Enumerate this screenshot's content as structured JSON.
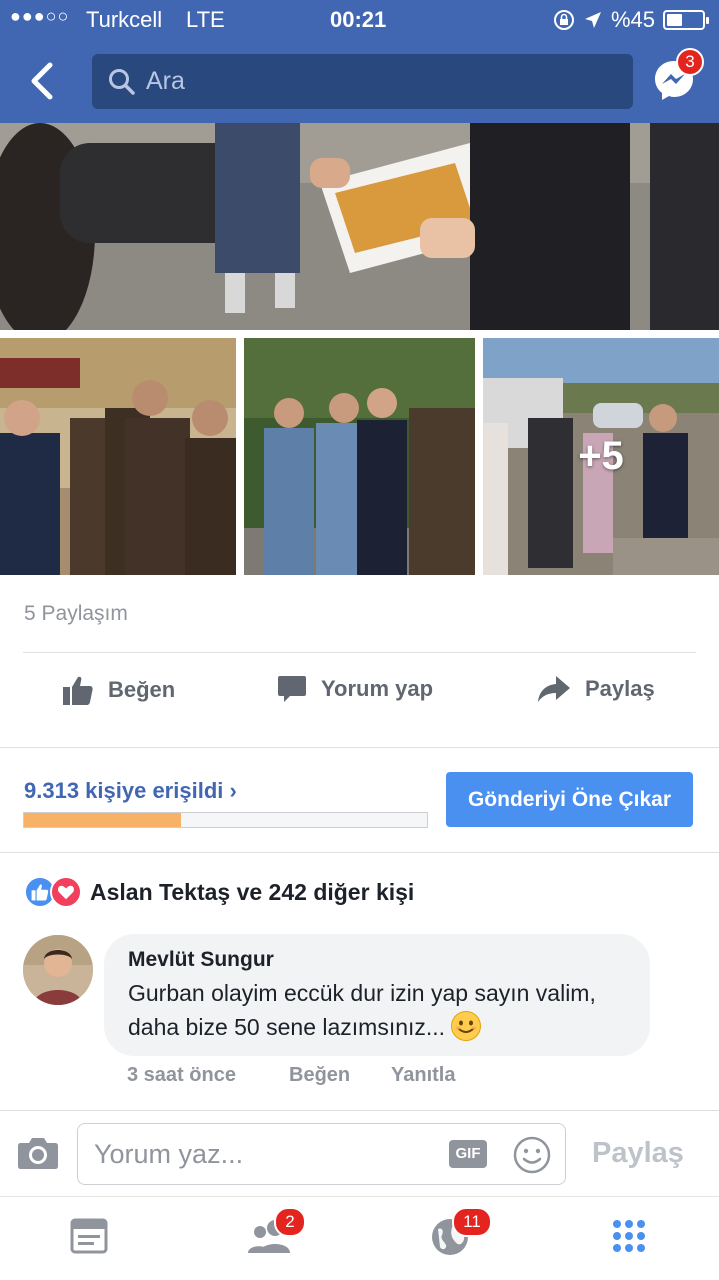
{
  "status_bar": {
    "signal": "●●●○○",
    "carrier": "Turkcell",
    "network": "LTE",
    "time": "00:21",
    "battery_text": "%45",
    "battery_level": 0.45
  },
  "nav": {
    "search_placeholder": "Ara",
    "messenger_badge": "3"
  },
  "photos": {
    "more_count": "+5"
  },
  "post": {
    "shares_text": "5 Paylaşım",
    "actions": {
      "like": "Beğen",
      "comment": "Yorum yap",
      "share": "Paylaş"
    },
    "reach_text": "9.313 kişiye erişildi",
    "reach_chevron": "›",
    "reach_progress": 0.39,
    "boost_label": "Gönderiyi Öne Çıkar",
    "reactions_text": "Aslan Tektaş ve 242 diğer kişi"
  },
  "comment": {
    "author": "Mevlüt Sungur",
    "text": "Gurban olayim eccük dur izin yap sayın valim, daha bize 50 sene lazımsınız...",
    "time": "3 saat önce",
    "like": "Beğen",
    "reply": "Yanıtla"
  },
  "composer": {
    "placeholder": "Yorum yaz...",
    "gif_label": "GIF",
    "post_label": "Paylaş"
  },
  "tabbar": {
    "friends_badge": "2",
    "notifications_badge": "11"
  },
  "colors": {
    "brand": "#4267b2",
    "badge": "#e4251f",
    "boost": "#4a90f0",
    "progress": "#f7b267"
  }
}
